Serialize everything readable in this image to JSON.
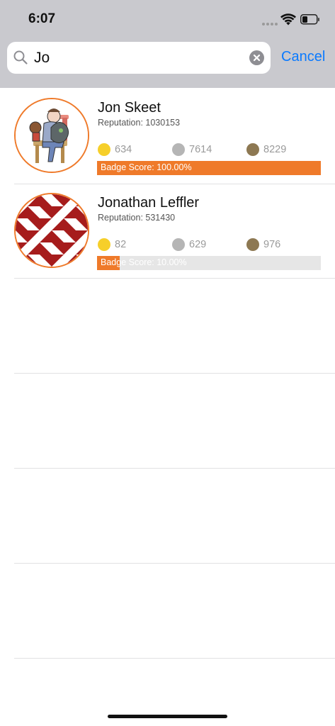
{
  "status_bar": {
    "time": "6:07",
    "icons": [
      "cellular-icon",
      "wifi-icon",
      "battery-icon"
    ]
  },
  "search": {
    "value": "Jo",
    "cancel_label": "Cancel",
    "icons": [
      "search-icon",
      "clear-icon"
    ]
  },
  "colors": {
    "accent_orange": "#ef7a2a",
    "gold": "#f6cf2a",
    "silver": "#b5b5b5",
    "bronze": "#8d7852",
    "link_blue": "#0a7aff"
  },
  "results": [
    {
      "name": "Jon Skeet",
      "reputation": "Reputation: 1030153",
      "gold": "634",
      "silver": "7614",
      "bronze": "8229",
      "badge_score_label": "Badge Score: 100.00%",
      "badge_score_fraction": 1.0
    },
    {
      "name": "Jonathan Leffler",
      "reputation": "Reputation: 531430",
      "gold": "82",
      "silver": "629",
      "bronze": "976",
      "badge_score_label": "Badge Score: 10.00%",
      "badge_score_fraction": 0.1
    }
  ]
}
